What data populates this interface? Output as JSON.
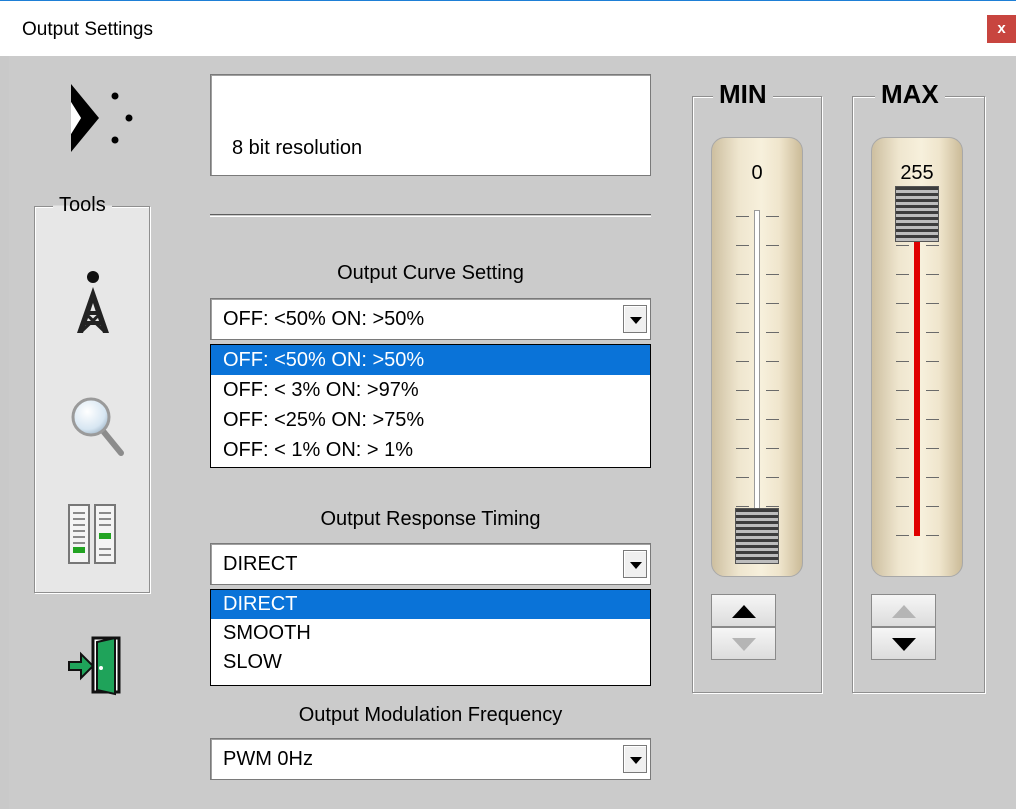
{
  "window": {
    "title": "Output Settings",
    "close_label": "x"
  },
  "tools": {
    "legend": "Tools",
    "icons": [
      "dmx-logo-icon",
      "antenna-tower-icon",
      "magnifier-icon",
      "fader-meter-icon",
      "exit-door-icon"
    ]
  },
  "info": {
    "text": "8 bit resolution"
  },
  "curve": {
    "label": "Output Curve Setting",
    "value": "OFF: <50%  ON: >50%",
    "options": [
      "OFF: <50%  ON: >50%",
      "OFF: < 3%  ON: >97%",
      "OFF: <25%  ON: >75%",
      "OFF: < 1%  ON: > 1%"
    ],
    "selected_index": 0
  },
  "timing": {
    "label": "Output Response Timing",
    "value": "DIRECT",
    "options": [
      "DIRECT",
      "SMOOTH",
      "SLOW"
    ],
    "selected_index": 0
  },
  "modulation": {
    "label": "Output Modulation Frequency",
    "value": "PWM  0Hz"
  },
  "min": {
    "legend": "MIN",
    "value": "0",
    "level": 0.0,
    "up_enabled": true,
    "down_enabled": false
  },
  "max": {
    "legend": "MAX",
    "value": "255",
    "level": 1.0,
    "up_enabled": false,
    "down_enabled": true
  },
  "colors": {
    "selection": "#0a73d8",
    "fill": "#e00000",
    "close": "#c8453f"
  }
}
